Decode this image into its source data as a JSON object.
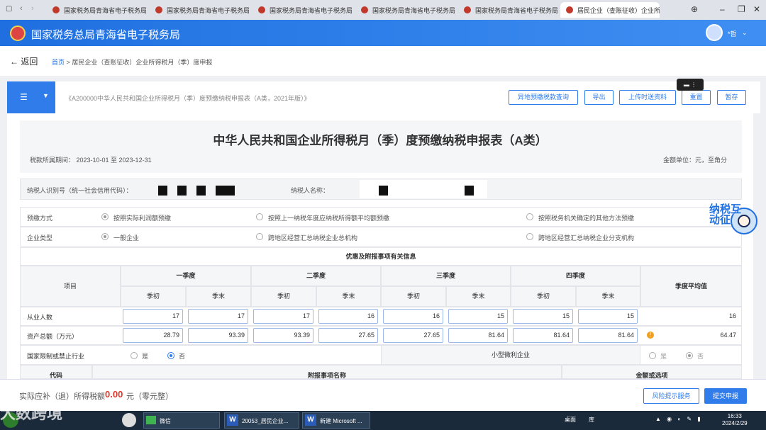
{
  "browser": {
    "tabs": [
      {
        "title": "国家税务局青海省电子税务局"
      },
      {
        "title": "国家税务局青海省电子税务局"
      },
      {
        "title": "国家税务局青海省电子税务局"
      },
      {
        "title": "国家税务局青海省电子税务局"
      },
      {
        "title": "国家税务局青海省电子税务局"
      },
      {
        "title": "居民企业（查账征收）企业所"
      }
    ],
    "close_glyph": "✕"
  },
  "header": {
    "site_title": "国家税务总局青海省电子税务局",
    "user_name": "*哲"
  },
  "breadcrumb": {
    "back_label": "返回",
    "home": "首页",
    "separator": ">",
    "current": "居民企业（查账征收）企业所得税月（季）度申报"
  },
  "toolbar": {
    "menu_glyph": "☰",
    "form_caption": "《A200000中华人民共和国企业所得税月（季）度预缴纳税申报表（A类，2021年版）》",
    "buttons": {
      "query": "异地预缴税款查询",
      "export": "导出",
      "upload": "上传时送资料",
      "reset": "重置",
      "save": "暂存"
    }
  },
  "form": {
    "title": "中华人民共和国企业所得税月（季）度预缴纳税申报表（A类）",
    "period": "税款所属期间：  2023-10-01 至 2023-12-31",
    "unit": "金额单位：元，至角分",
    "taxpayer_id_label": "纳税人识别号（统一社会信用代码）：",
    "taxpayer_name_label": "纳税人名称："
  },
  "prepay": {
    "method_label": "预缴方式",
    "methods": [
      "按照实际利润额预缴",
      "按照上一纳税年度应纳税所得额平均额预缴",
      "按照税务机关确定的其他方法预缴"
    ],
    "type_label": "企业类型",
    "types": [
      "一般企业",
      "跨地区经营汇总纳税企业总机构",
      "跨地区经营汇总纳税企业分支机构"
    ]
  },
  "table": {
    "section_title": "优惠及附报事项有关信息",
    "item_header": "项目",
    "quarters": [
      "一季度",
      "二季度",
      "三季度",
      "四季度"
    ],
    "sub_headers": [
      "季初",
      "季末"
    ],
    "avg_header": "季度平均值",
    "rows": [
      {
        "label": "从业人数",
        "values": [
          "17",
          "17",
          "17",
          "16",
          "16",
          "15",
          "15",
          "15"
        ],
        "avg": "16"
      },
      {
        "label": "资产总额（万元）",
        "values": [
          "28.79",
          "93.39",
          "93.39",
          "27.65",
          "27.65",
          "81.64",
          "81.64",
          "81.64"
        ],
        "avg": "64.47"
      }
    ],
    "restricted_label": "国家限制或禁止行业",
    "yes": "是",
    "no": "否",
    "small_micro_label": "小型微利企业",
    "code_header": "代码",
    "attach_header": "附报事项名称",
    "amount_header": "金额或选项"
  },
  "footer": {
    "tax_label": "实际应补（退）所得税额",
    "tax_amount": "0.00",
    "tax_unit": "元（零元整）",
    "risk_button": "风险提示服务",
    "submit_button": "提交申报"
  },
  "mascot": {
    "text": "纳税互动征"
  },
  "taskbar": {
    "watermark": "大数跨境",
    "items": [
      "微信",
      "20053_居民企业...",
      "新建 Microsoft ..."
    ],
    "tray_desktop": "桌面",
    "tray_lib": "库",
    "time": "16:33",
    "date": "2024/2/29"
  },
  "colors": {
    "primary": "#2f7cea",
    "amount_red": "#e0372c",
    "header_blue": "#1f6fe0"
  }
}
